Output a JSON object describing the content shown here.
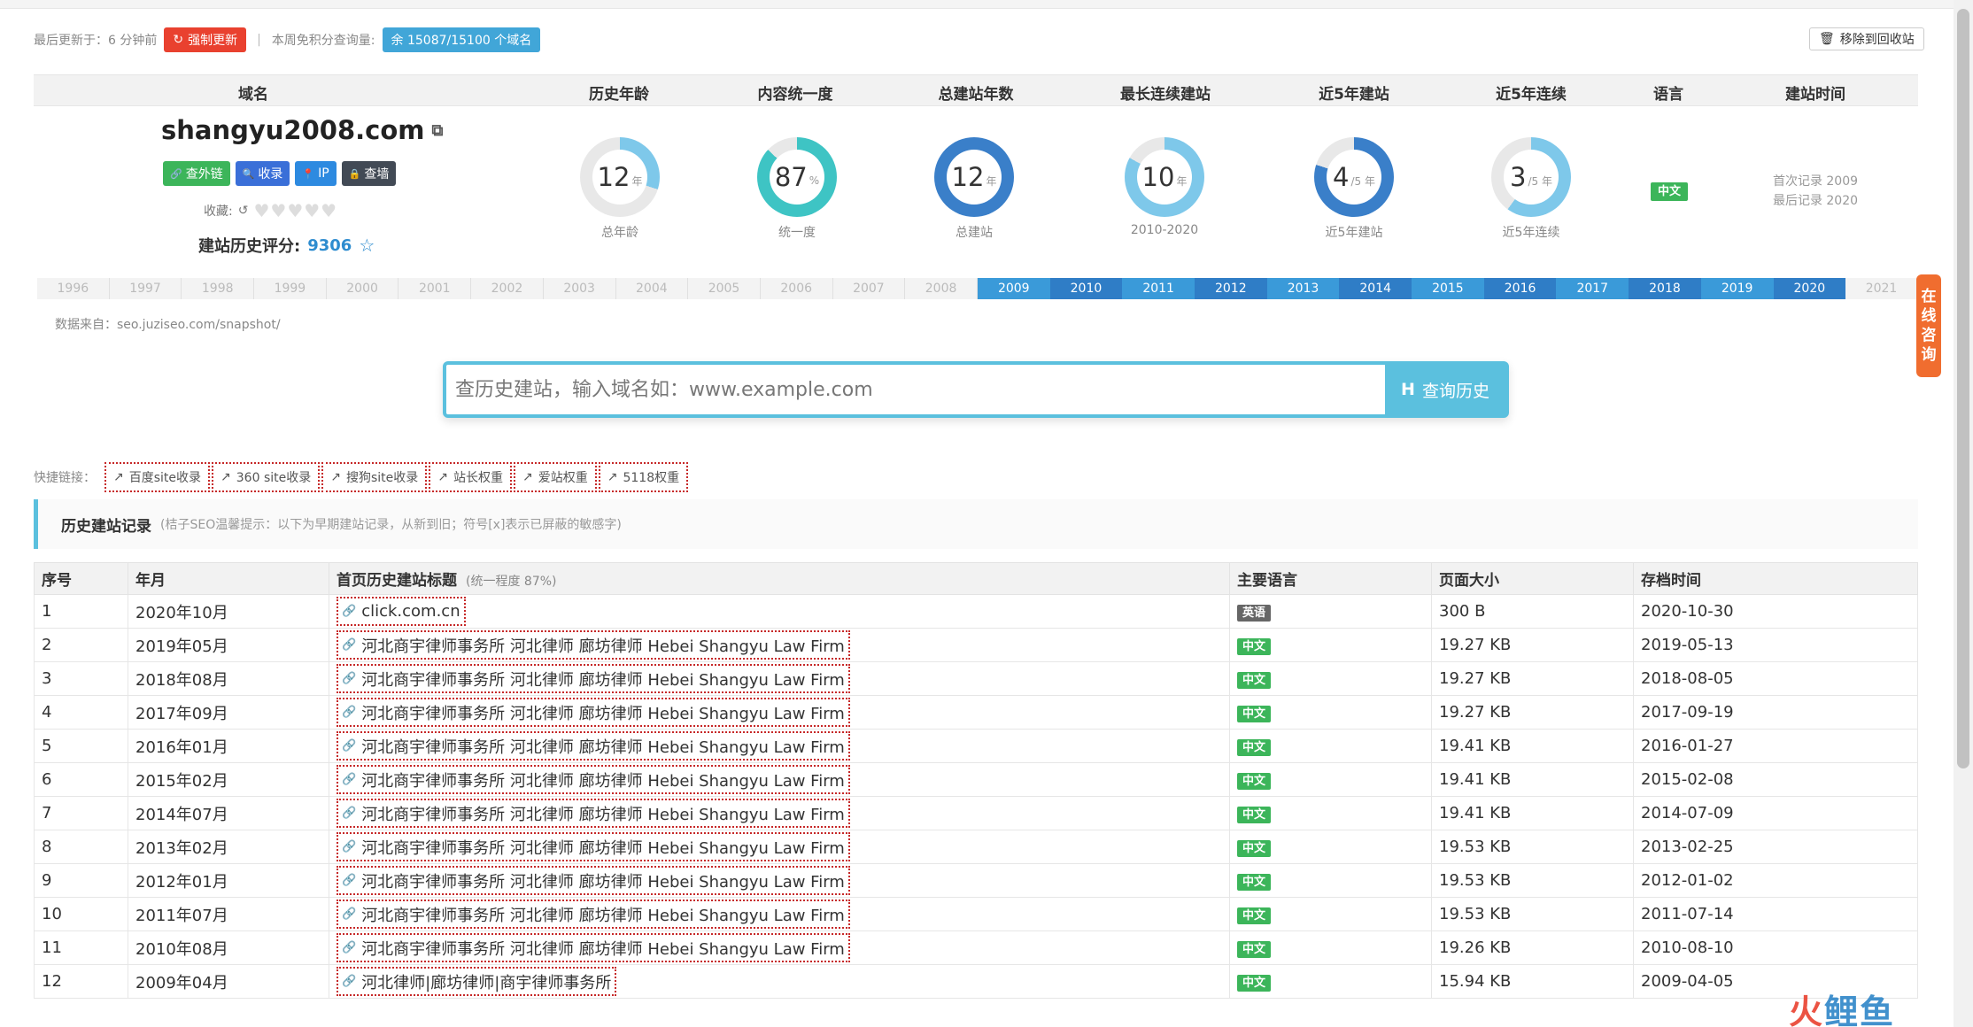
{
  "status": {
    "last_update_label": "最后更新于：6 分钟前",
    "force_update_label": "强制更新",
    "weekly_points_label": "本周免积分查询量:",
    "remaining_label": "余 15087/15100 个域名",
    "recycle_label": "移除到回收站"
  },
  "summary": {
    "headers": [
      "域名",
      "历史年龄",
      "内容统一度",
      "总建站年数",
      "最长连续建站",
      "近5年建站",
      "近5年连续",
      "语言",
      "建站时间"
    ],
    "domain": "shangyu2008.com",
    "buttons": [
      {
        "label": "查外链",
        "color": "#3cb55a"
      },
      {
        "label": "收录",
        "color": "#3a6fd8"
      },
      {
        "label": "IP",
        "color": "#2d8ae0"
      },
      {
        "label": "查墙",
        "color": "#424a55"
      }
    ],
    "favorites_label": "收藏:",
    "score_label": "建站历史评分:",
    "score_value": "9306",
    "rings": [
      {
        "value": "12",
        "unit": "年",
        "caption": "总年龄",
        "percent": 30,
        "color": "#7ec8ea"
      },
      {
        "value": "87",
        "unit": "%",
        "caption": "统一度",
        "percent": 87,
        "color": "#3ec4c4"
      },
      {
        "value": "12",
        "unit": "年",
        "caption": "总建站",
        "percent": 100,
        "color": "#3a7fc9"
      },
      {
        "value": "10",
        "unit": "年",
        "caption": "2010-2020",
        "percent": 83,
        "color": "#7ec8ea"
      },
      {
        "value": "4",
        "unit": "/5 年",
        "caption": "近5年建站",
        "percent": 80,
        "color": "#3a7fc9"
      },
      {
        "value": "3",
        "unit": "/5 年",
        "caption": "近5年连续",
        "percent": 60,
        "color": "#7ec8ea"
      }
    ],
    "language": "中文",
    "first_record": "首次记录 2009",
    "last_record": "最后记录 2020"
  },
  "timeline": [
    {
      "year": "1996",
      "active": false
    },
    {
      "year": "1997",
      "active": false
    },
    {
      "year": "1998",
      "active": false
    },
    {
      "year": "1999",
      "active": false
    },
    {
      "year": "2000",
      "active": false
    },
    {
      "year": "2001",
      "active": false
    },
    {
      "year": "2002",
      "active": false
    },
    {
      "year": "2003",
      "active": false
    },
    {
      "year": "2004",
      "active": false
    },
    {
      "year": "2005",
      "active": false
    },
    {
      "year": "2006",
      "active": false
    },
    {
      "year": "2007",
      "active": false
    },
    {
      "year": "2008",
      "active": false
    },
    {
      "year": "2009",
      "active": true
    },
    {
      "year": "2010",
      "active": true
    },
    {
      "year": "2011",
      "active": true
    },
    {
      "year": "2012",
      "active": true
    },
    {
      "year": "2013",
      "active": true
    },
    {
      "year": "2014",
      "active": true
    },
    {
      "year": "2015",
      "active": true
    },
    {
      "year": "2016",
      "active": true
    },
    {
      "year": "2017",
      "active": true
    },
    {
      "year": "2018",
      "active": true
    },
    {
      "year": "2019",
      "active": true
    },
    {
      "year": "2020",
      "active": true
    },
    {
      "year": "2021",
      "active": false
    }
  ],
  "timeline_colors": {
    "a": "#2f7dc6",
    "b": "#3a9ad9",
    "off_text": "#bbbbbb"
  },
  "data_source": "数据来自：seo.juziseo.com/snapshot/",
  "search": {
    "placeholder": "查历史建站，输入域名如：www.example.com",
    "button_label": "查询历史"
  },
  "quick_links": {
    "label": "快捷链接：",
    "items": [
      "百度site收录",
      "360 site收录",
      "搜狗site收录",
      "站长权重",
      "爱站权重",
      "5118权重"
    ]
  },
  "history": {
    "title": "历史建站记录",
    "tip": "(桔子SEO温馨提示：以下为早期建站记录，从新到旧；符号[x]表示已屏蔽的敏感字)",
    "columns": [
      "序号",
      "年月",
      "首页历史建站标题",
      "主要语言",
      "页面大小",
      "存档时间"
    ],
    "title_note": "(统一程度 87%)",
    "rows": [
      {
        "no": "1",
        "month": "2020年10月",
        "title": "click.com.cn",
        "lang": "英语",
        "lang_color": "#666666",
        "size": "300 B",
        "date": "2020-10-30"
      },
      {
        "no": "2",
        "month": "2019年05月",
        "title": "河北商宇律师事务所 河北律师 廊坊律师 Hebei Shangyu Law Firm",
        "lang": "中文",
        "lang_color": "#3cb55a",
        "size": "19.27 KB",
        "date": "2019-05-13"
      },
      {
        "no": "3",
        "month": "2018年08月",
        "title": "河北商宇律师事务所 河北律师 廊坊律师 Hebei Shangyu Law Firm",
        "lang": "中文",
        "lang_color": "#3cb55a",
        "size": "19.27 KB",
        "date": "2018-08-05"
      },
      {
        "no": "4",
        "month": "2017年09月",
        "title": "河北商宇律师事务所 河北律师 廊坊律师 Hebei Shangyu Law Firm",
        "lang": "中文",
        "lang_color": "#3cb55a",
        "size": "19.27 KB",
        "date": "2017-09-19"
      },
      {
        "no": "5",
        "month": "2016年01月",
        "title": "河北商宇律师事务所 河北律师 廊坊律师 Hebei Shangyu Law Firm",
        "lang": "中文",
        "lang_color": "#3cb55a",
        "size": "19.41 KB",
        "date": "2016-01-27"
      },
      {
        "no": "6",
        "month": "2015年02月",
        "title": "河北商宇律师事务所 河北律师 廊坊律师 Hebei Shangyu Law Firm",
        "lang": "中文",
        "lang_color": "#3cb55a",
        "size": "19.41 KB",
        "date": "2015-02-08"
      },
      {
        "no": "7",
        "month": "2014年07月",
        "title": "河北商宇律师事务所 河北律师 廊坊律师 Hebei Shangyu Law Firm",
        "lang": "中文",
        "lang_color": "#3cb55a",
        "size": "19.41 KB",
        "date": "2014-07-09"
      },
      {
        "no": "8",
        "month": "2013年02月",
        "title": "河北商宇律师事务所 河北律师 廊坊律师 Hebei Shangyu Law Firm",
        "lang": "中文",
        "lang_color": "#3cb55a",
        "size": "19.53 KB",
        "date": "2013-02-25"
      },
      {
        "no": "9",
        "month": "2012年01月",
        "title": "河北商宇律师事务所 河北律师 廊坊律师 Hebei Shangyu Law Firm",
        "lang": "中文",
        "lang_color": "#3cb55a",
        "size": "19.53 KB",
        "date": "2012-01-02"
      },
      {
        "no": "10",
        "month": "2011年07月",
        "title": "河北商宇律师事务所 河北律师 廊坊律师 Hebei Shangyu Law Firm",
        "lang": "中文",
        "lang_color": "#3cb55a",
        "size": "19.53 KB",
        "date": "2011-07-14"
      },
      {
        "no": "11",
        "month": "2010年08月",
        "title": "河北商宇律师事务所 河北律师 廊坊律师 Hebei Shangyu Law Firm",
        "lang": "中文",
        "lang_color": "#3cb55a",
        "size": "19.26 KB",
        "date": "2010-08-10"
      },
      {
        "no": "12",
        "month": "2009年04月",
        "title": "河北律师|廊坊律师|商宇律师事务所",
        "lang": "中文",
        "lang_color": "#3cb55a",
        "size": "15.94 KB",
        "date": "2009-04-05"
      }
    ]
  },
  "consult": {
    "label": "在线咨询"
  },
  "watermark": {
    "a": "火",
    "b": "鲤",
    "c": "鱼"
  }
}
